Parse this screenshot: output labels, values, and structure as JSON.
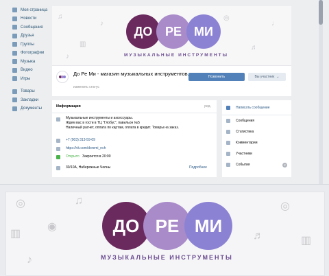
{
  "sidebar": {
    "items": [
      {
        "label": "Моя страница",
        "icon": "home-icon"
      },
      {
        "label": "Новости",
        "icon": "news-icon"
      },
      {
        "label": "Сообщения",
        "icon": "messages-icon"
      },
      {
        "label": "Друзья",
        "icon": "friends-icon"
      },
      {
        "label": "Группы",
        "icon": "groups-icon"
      },
      {
        "label": "Фотографии",
        "icon": "photos-icon"
      },
      {
        "label": "Музыка",
        "icon": "music-icon"
      },
      {
        "label": "Видео",
        "icon": "video-icon"
      },
      {
        "label": "Игры",
        "icon": "games-icon"
      }
    ],
    "items2": [
      {
        "label": "Товары",
        "icon": "goods-icon"
      },
      {
        "label": "Закладки",
        "icon": "bookmarks-icon"
      },
      {
        "label": "Документы",
        "icon": "documents-icon"
      }
    ]
  },
  "cover": {
    "syllables": [
      "ДО",
      "РЕ",
      "МИ"
    ],
    "subtitle": "МУЗЫКАЛЬНЫЕ ИНСТРУМЕНТЫ",
    "colors": [
      "#6b2a5e",
      "#a98bc9",
      "#8c82d4"
    ]
  },
  "header": {
    "title": "До Ре Ми - магазин музыкальных инструментов.",
    "status_placeholder": "изменить статус",
    "write_button": "Позвонить",
    "member_button": "Вы участник"
  },
  "info": {
    "title": "Информация",
    "edit": "ред.",
    "description": "Музыкальные инструменты и аксессуары.\nЖдем вас в гости в ТЦ \"Глобус\", павильон №5\nНаличный расчет, оплата по картам, оплата в кредит. Товары на заказ.",
    "phone": "+7 (903) 313-59-09",
    "website": "https://vk.com/doremi_nch",
    "open_status": "Открыто",
    "closes": "Закроется в 20:00",
    "address": "30/10А, Набережные Челны",
    "more": "Подробнее"
  },
  "right_menu": {
    "write_message": "Написать сообщение",
    "items": [
      {
        "label": "Сообщения",
        "icon": "messages-icon",
        "badge": ""
      },
      {
        "label": "Статистика",
        "icon": "stats-icon",
        "badge": ""
      },
      {
        "label": "Комментарии",
        "icon": "comments-icon",
        "badge": ""
      },
      {
        "label": "Участники",
        "icon": "members-icon",
        "badge": ""
      },
      {
        "label": "События",
        "icon": "events-icon",
        "badge": "2"
      }
    ]
  }
}
